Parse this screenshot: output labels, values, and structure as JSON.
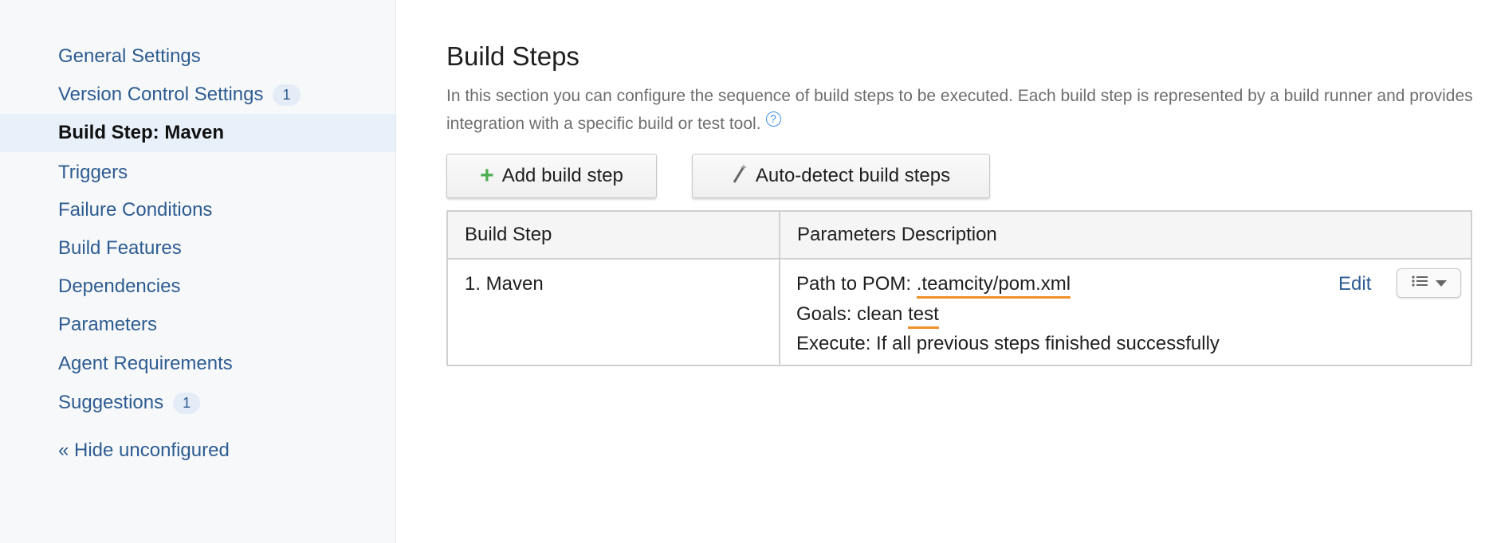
{
  "sidebar": {
    "items": [
      {
        "label": "General Settings",
        "badge": null,
        "active": false
      },
      {
        "label": "Version Control Settings",
        "badge": "1",
        "active": false
      },
      {
        "label": "Build Step: Maven",
        "badge": null,
        "active": true
      },
      {
        "label": "Triggers",
        "badge": null,
        "active": false
      },
      {
        "label": "Failure Conditions",
        "badge": null,
        "active": false
      },
      {
        "label": "Build Features",
        "badge": null,
        "active": false
      },
      {
        "label": "Dependencies",
        "badge": null,
        "active": false
      },
      {
        "label": "Parameters",
        "badge": null,
        "active": false
      },
      {
        "label": "Agent Requirements",
        "badge": null,
        "active": false
      },
      {
        "label": "Suggestions",
        "badge": "1",
        "active": false
      }
    ],
    "hide_link": "« Hide unconfigured"
  },
  "main": {
    "title": "Build Steps",
    "description": "In this section you can configure the sequence of build steps to be executed. Each build step is represented by a build runner and provides integration with a specific build or test tool.",
    "help_icon": "?",
    "buttons": {
      "add": "Add build step",
      "autodetect": "Auto-detect build steps"
    },
    "table": {
      "headers": [
        "Build Step",
        "Parameters Description"
      ],
      "rows": [
        {
          "step": "1. Maven",
          "pom_label": "Path to POM: ",
          "pom_value": ".teamcity/pom.xml",
          "goals_label": "Goals: clean ",
          "goals_value": "test",
          "execute": "Execute: If all previous steps finished successfully",
          "edit": "Edit"
        }
      ]
    }
  },
  "colors": {
    "link": "#2d5c91",
    "underline": "#f0902a",
    "active_bg": "#e8f0fa"
  }
}
